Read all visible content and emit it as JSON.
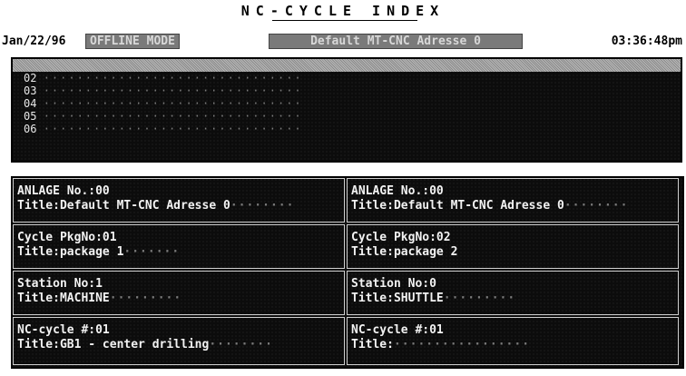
{
  "window": {
    "title": "NC-CYCLE INDEX"
  },
  "status_bar": {
    "date": "Jan/22/96",
    "mode": "OFFLINE MODE",
    "address": "Default MT-CNC Adresse 0",
    "time": "03:36:48pm"
  },
  "list": {
    "rows": [
      {
        "num": "02",
        "dots": "·······························"
      },
      {
        "num": "03",
        "dots": "·······························"
      },
      {
        "num": "04",
        "dots": "·······························"
      },
      {
        "num": "05",
        "dots": "·······························"
      },
      {
        "num": "06",
        "dots": "·······························"
      }
    ]
  },
  "panels": {
    "left": {
      "anlage": "ANLAGE No.:00",
      "anlage_title": "Title:Default MT-CNC Adresse 0",
      "anlage_dots": "········",
      "cycle": "Cycle PkgNo:01",
      "cycle_title": "Title:package 1",
      "cycle_dots": "·······",
      "station": "Station No:1",
      "station_title": "Title:MACHINE",
      "station_dots": "·········",
      "nc": "NC-cycle #:01",
      "nc_title": "Title:GB1 - center drilling",
      "nc_dots": "········"
    },
    "right": {
      "anlage": "ANLAGE No.:00",
      "anlage_title": "Title:Default MT-CNC Adresse 0",
      "anlage_dots": "········",
      "cycle": "Cycle PkgNo:02",
      "cycle_title": "Title:package 2",
      "cycle_dots": "",
      "station": "Station No:0",
      "station_title": "Title:SHUTTLE",
      "station_dots": "·········",
      "nc": "NC-cycle #:01",
      "nc_title": "Title:",
      "nc_dots": "·················"
    }
  }
}
